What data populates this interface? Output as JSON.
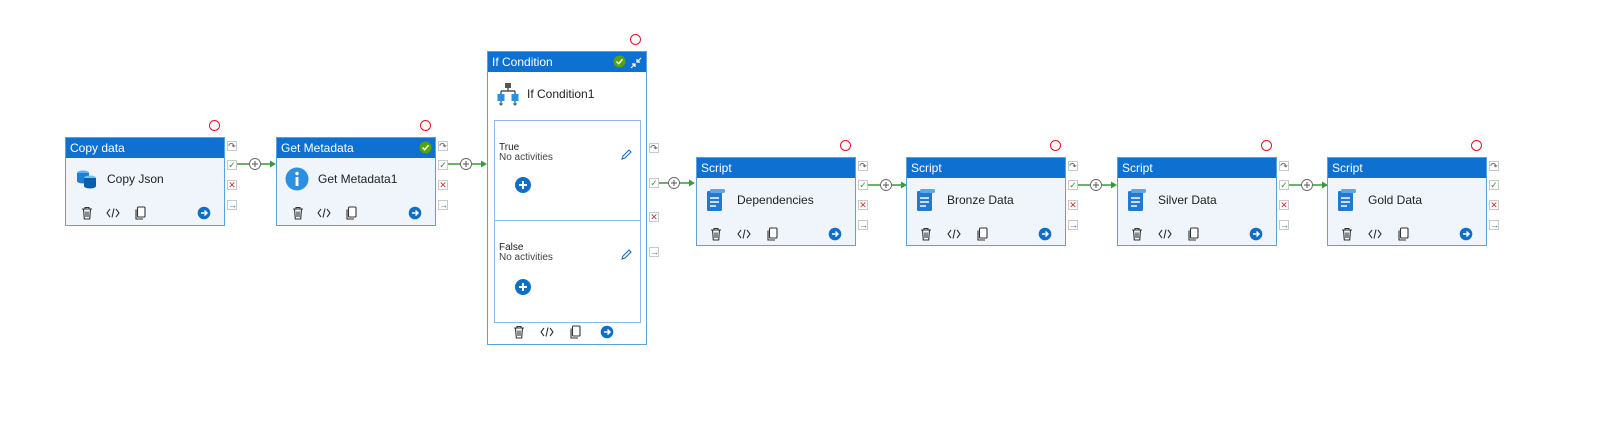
{
  "activities": [
    {
      "type_label": "Copy data",
      "name": "Copy Json",
      "icon": "copy-data-icon"
    },
    {
      "type_label": "Get Metadata",
      "name": "Get Metadata1",
      "icon": "info-icon"
    },
    {
      "type_label": "Script",
      "name": "Dependencies",
      "icon": "script-icon"
    },
    {
      "type_label": "Script",
      "name": "Bronze Data",
      "icon": "script-icon"
    },
    {
      "type_label": "Script",
      "name": "Silver Data",
      "icon": "script-icon"
    },
    {
      "type_label": "Script",
      "name": "Gold Data",
      "icon": "script-icon"
    }
  ],
  "if_condition": {
    "type_label": "If Condition",
    "name": "If Condition1",
    "true_branch": {
      "label": "True",
      "status": "No activities"
    },
    "false_branch": {
      "label": "False",
      "status": "No activities"
    }
  },
  "colors": {
    "header": "#0e70d1",
    "border": "#5aa2dc",
    "body": "#eff5fb",
    "success": "#2f9d2f",
    "failure": "#d32f2f",
    "validation_ring": "#e81123"
  }
}
